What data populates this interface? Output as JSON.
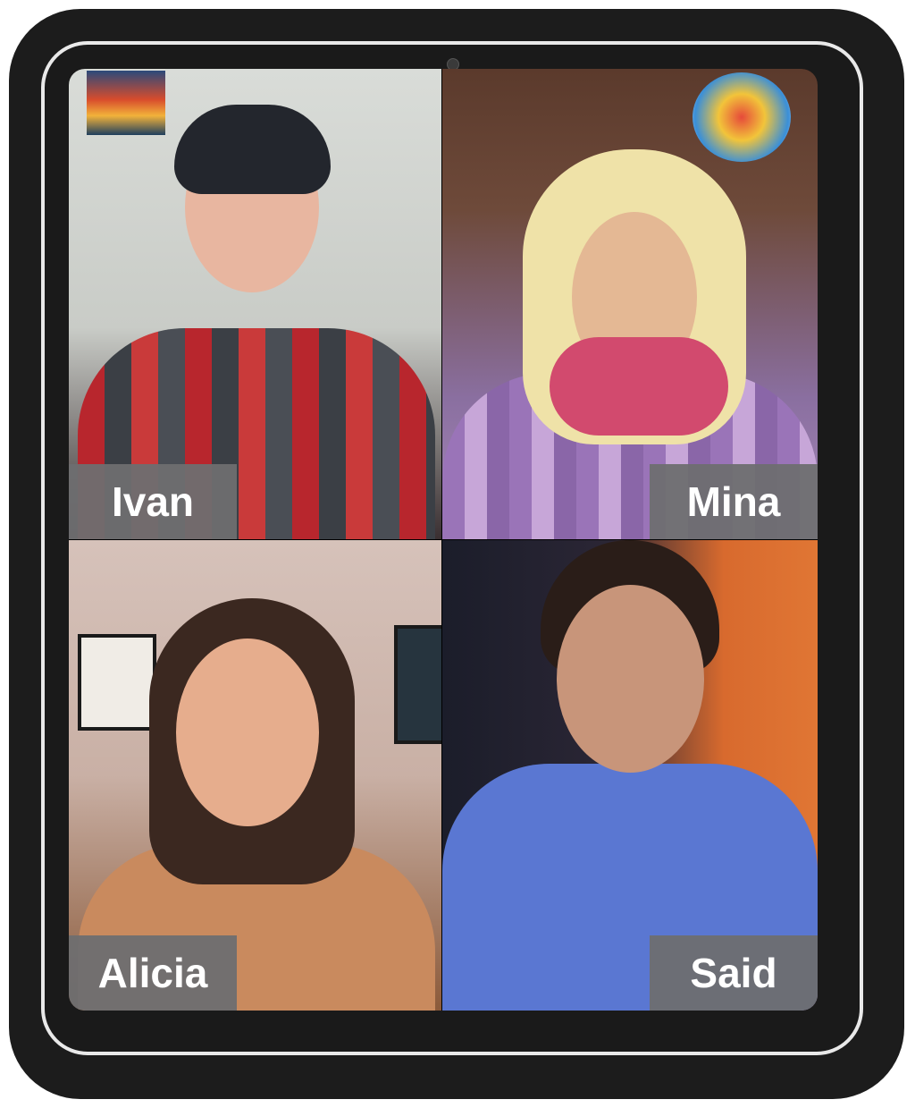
{
  "participants": [
    {
      "name": "Ivan"
    },
    {
      "name": "Mina"
    },
    {
      "name": "Alicia"
    },
    {
      "name": "Said"
    }
  ],
  "colors": {
    "device_frame": "#1c1c1c",
    "bezel_border": "#e9e9e9",
    "label_background": "#6e6e70",
    "label_text": "#ffffff"
  }
}
